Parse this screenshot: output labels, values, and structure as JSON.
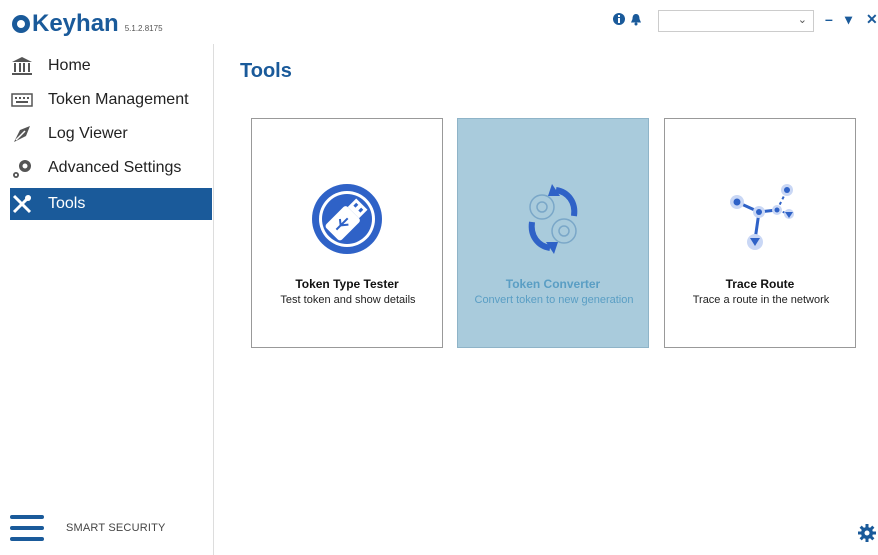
{
  "app": {
    "name": "Keyhan",
    "version": "5.1.2.8175",
    "brand_color": "#1a5a9a"
  },
  "titlebar": {
    "info_icon": "info-icon",
    "bell_icon": "bell-icon",
    "dropdown_value": "",
    "minimize": "–",
    "restore": "▾",
    "close": "✕"
  },
  "sidebar": {
    "items": [
      {
        "label": "Home",
        "icon": "home-icon"
      },
      {
        "label": "Token Management",
        "icon": "keyboard-icon"
      },
      {
        "label": "Log Viewer",
        "icon": "log-icon"
      },
      {
        "label": "Advanced Settings",
        "icon": "settings-icon"
      },
      {
        "label": "Tools",
        "icon": "tools-icon",
        "active": true
      }
    ],
    "footer_label": "SMART SECURITY"
  },
  "main": {
    "title": "Tools",
    "cards": [
      {
        "title": "Token Type Tester",
        "desc": "Test token and show details",
        "icon": "usb-token-icon"
      },
      {
        "title": "Token Converter",
        "desc": "Convert token to new generation",
        "icon": "convert-icon",
        "selected": true
      },
      {
        "title": "Trace Route",
        "desc": "Trace a route in the network",
        "icon": "network-route-icon"
      }
    ]
  }
}
